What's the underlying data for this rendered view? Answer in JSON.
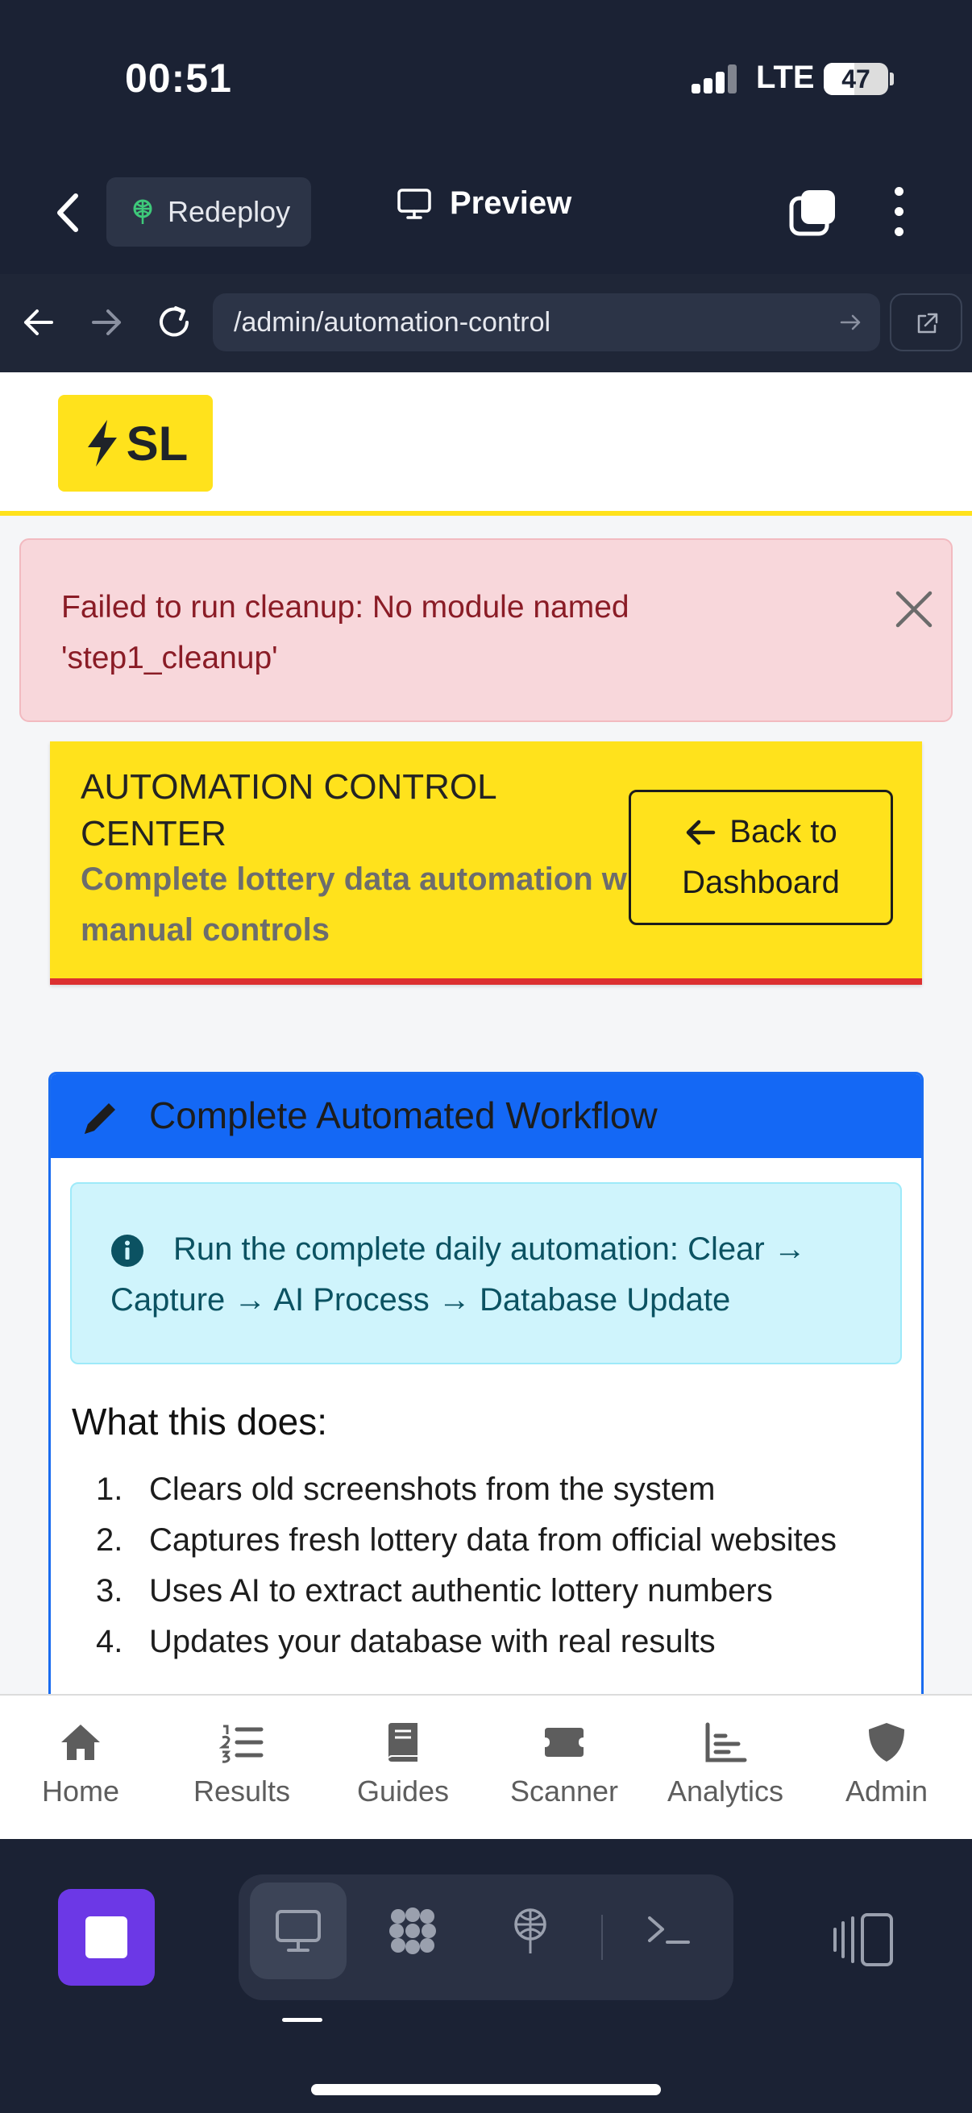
{
  "status_bar": {
    "time": "00:51",
    "network": "LTE",
    "battery": "47",
    "battery_level_percent": 47
  },
  "toolbar": {
    "redeploy_label": "Redeploy",
    "preview_label": "Preview"
  },
  "browser": {
    "url": "/admin/automation-control"
  },
  "site": {
    "logo_text": "SL",
    "alert": {
      "message": "Failed to run cleanup: No module named 'step1_cleanup'"
    },
    "hero": {
      "title": "AUTOMATION CONTROL CENTER",
      "subtitle": "Complete lottery data automation with manual controls",
      "back_line1": "Back to",
      "back_line2": "Dashboard"
    },
    "workflow": {
      "title": "Complete Automated Workflow",
      "info": "Run the complete daily automation: Clear → Capture → AI Process → Database Update",
      "what_title": "What this does:",
      "steps": [
        {
          "n": "1.",
          "text": "Clears old screenshots from the system"
        },
        {
          "n": "2.",
          "text": "Captures fresh lottery data from official websites"
        },
        {
          "n": "3.",
          "text": "Uses AI to extract authentic lottery numbers"
        },
        {
          "n": "4.",
          "text": "Updates your database with real results"
        }
      ]
    },
    "tabs": [
      "Home",
      "Results",
      "Guides",
      "Scanner",
      "Analytics",
      "Admin"
    ]
  },
  "colors": {
    "accent_yellow": "#ffe21c",
    "accent_red": "#dc3030",
    "primary_blue": "#1468f5",
    "alert_bg": "#f8d7db",
    "info_bg": "#cff4fc",
    "replit_purple": "#6c38e6"
  },
  "icons": {
    "toolbar": [
      "chevron-left-icon",
      "redeploy-icon",
      "monitor-icon",
      "tabs-icon",
      "kebab-icon"
    ],
    "browser": [
      "arrow-left-icon",
      "arrow-right-icon",
      "reload-icon",
      "go-arrow-icon",
      "open-external-icon"
    ],
    "tabs": [
      "home-icon",
      "list-ol-icon",
      "book-icon",
      "ticket-icon",
      "chart-icon",
      "shield-icon"
    ],
    "dock": [
      "stop-icon",
      "monitor-icon",
      "apps-icon",
      "deploy-icon",
      "terminal-icon",
      "side-panel-icon"
    ]
  }
}
